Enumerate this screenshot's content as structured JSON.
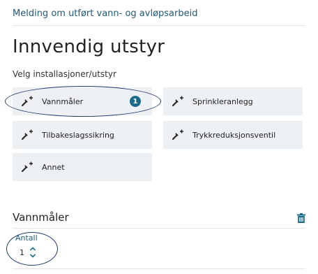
{
  "breadcrumb": "Melding om utført vann- og avløpsarbeid",
  "page_title": "Innvendig utstyr",
  "subtitle": "Velg installasjoner/utstyr",
  "options": [
    {
      "label": "Vannmåler",
      "badge": "1"
    },
    {
      "label": "Sprinkleranlegg"
    },
    {
      "label": "Tilbakeslagssikring"
    },
    {
      "label": "Trykkreduksjonsventil"
    },
    {
      "label": "Annet"
    }
  ],
  "section": {
    "title": "Vannmåler",
    "quantity_label": "Antall",
    "quantity_value": "1"
  },
  "icons": {
    "option": "wrench-plus-icon",
    "delete": "trash-icon",
    "stepper": "chevron-up-down-icon"
  },
  "colors": {
    "accent": "#1a6b8a",
    "link": "#1f5a7a",
    "card_bg": "#eef1f3",
    "annotation": "#1f3a6e"
  }
}
